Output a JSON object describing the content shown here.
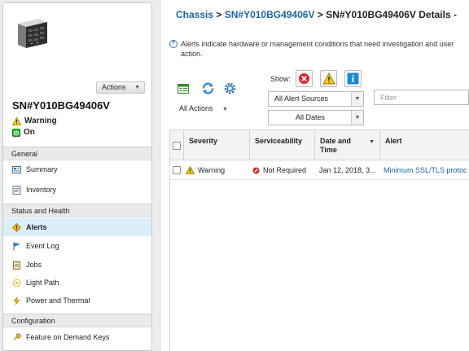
{
  "device": {
    "title": "SN#Y010BG49406V",
    "actions_label": "Actions",
    "status": "Warning",
    "power": "On"
  },
  "sidebar": {
    "sections": [
      {
        "header": "General",
        "items": [
          {
            "label": "Summary",
            "icon": "summary-icon"
          },
          {
            "label": "Inventory",
            "icon": "inventory-icon"
          }
        ]
      },
      {
        "header": "Status and Health",
        "items": [
          {
            "label": "Alerts",
            "icon": "alert-diamond-icon",
            "active": true
          },
          {
            "label": "Event Log",
            "icon": "flag-icon"
          },
          {
            "label": "Jobs",
            "icon": "clipboard-icon"
          },
          {
            "label": "Light Path",
            "icon": "lightbulb-icon"
          },
          {
            "label": "Power and Thermal",
            "icon": "power-thermal-icon"
          }
        ]
      },
      {
        "header": "Configuration",
        "items": [
          {
            "label": "Feature on Demand Keys",
            "icon": "key-icon"
          }
        ]
      }
    ]
  },
  "breadcrumb": {
    "root": "Chassis",
    "device": "SN#Y010BG49406V",
    "current": "SN#Y010BG49406V Details -",
    "sep": ">"
  },
  "help_text": "Alerts indicate hardware or management conditions that need investigation and user action.",
  "toolbar": {
    "all_actions": "All Actions",
    "show_label": "Show:",
    "source_select": "All Alert Sources",
    "date_select": "All Dates",
    "filter_placeholder": "Filter"
  },
  "table": {
    "columns": [
      "Severity",
      "Serviceability",
      "Date and Time",
      "Alert"
    ],
    "rows": [
      {
        "severity": "Warning",
        "serviceability": "Not Required",
        "date": "Jan 12, 2018, 3...",
        "alert": "Minimum SSL/TLS protoc"
      }
    ]
  },
  "colors": {
    "link": "#1d62a8",
    "active_nav": "#dceefa",
    "critical": "#d9262b",
    "warning": "#f5d20b",
    "info": "#1e88d4"
  }
}
